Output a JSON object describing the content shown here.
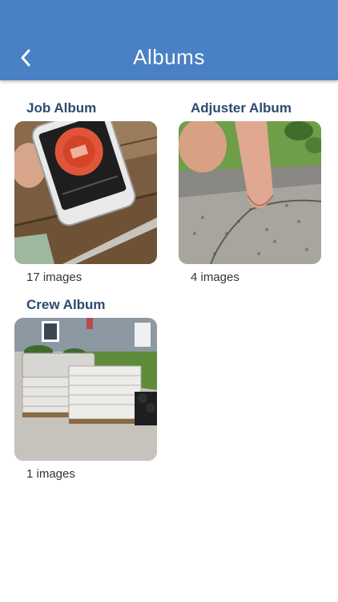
{
  "header": {
    "title": "Albums",
    "back_icon": "chevron-left-icon",
    "background_color": "#4a80c4"
  },
  "albums": [
    {
      "name": "Job Album",
      "count_label": "17 images"
    },
    {
      "name": "Adjuster Album",
      "count_label": "4 images"
    },
    {
      "name": "Crew Album",
      "count_label": "1 images"
    }
  ]
}
